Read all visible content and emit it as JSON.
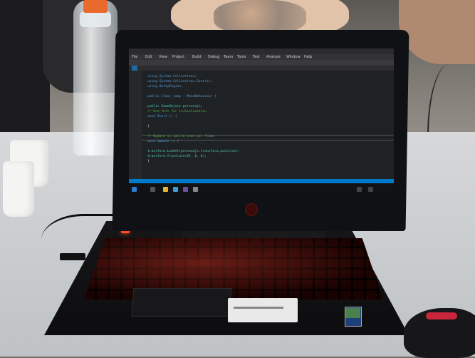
{
  "scene": {
    "description_none": ""
  },
  "ide": {
    "menu": [
      "File",
      "Edit",
      "View",
      "Project",
      "Build",
      "Debug",
      "Team",
      "Tools",
      "Test",
      "Analyze",
      "Window",
      "Help"
    ],
    "tab_label": "",
    "code_lines": [
      {
        "cls": "kw",
        "text": "using System.Collections;"
      },
      {
        "cls": "kw",
        "text": "using System.Collections.Generic;"
      },
      {
        "cls": "kw",
        "text": "using UnityEngine;"
      },
      {
        "cls": "pl",
        "text": ""
      },
      {
        "cls": "kw",
        "text": "public class jump : MonoBehaviour {"
      },
      {
        "cls": "pl",
        "text": ""
      },
      {
        "cls": "ty",
        "text": "    public GameObject personaje;"
      },
      {
        "cls": "cm",
        "text": "    // Use this for initialization"
      },
      {
        "cls": "kw",
        "text": "    void Start () {"
      },
      {
        "cls": "pl",
        "text": ""
      },
      {
        "cls": "pl",
        "text": "    }"
      },
      {
        "cls": "pl",
        "text": ""
      },
      {
        "cls": "cm",
        "text": "    // Update is called once per frame"
      },
      {
        "cls": "kw",
        "text": "    void Update () {"
      },
      {
        "cls": "pl",
        "text": ""
      },
      {
        "cls": "ty",
        "text": "        transform.LookAt(personaje.transform.position);"
      },
      {
        "cls": "ty",
        "text": "        transform.Translate(0f, 0, 0);"
      },
      {
        "cls": "pl",
        "text": "    }"
      }
    ]
  },
  "colors": {
    "keyboard_backlight": "#ff2d23",
    "ide_accent": "#007acc",
    "bottle_cap": "#e96a2c"
  }
}
